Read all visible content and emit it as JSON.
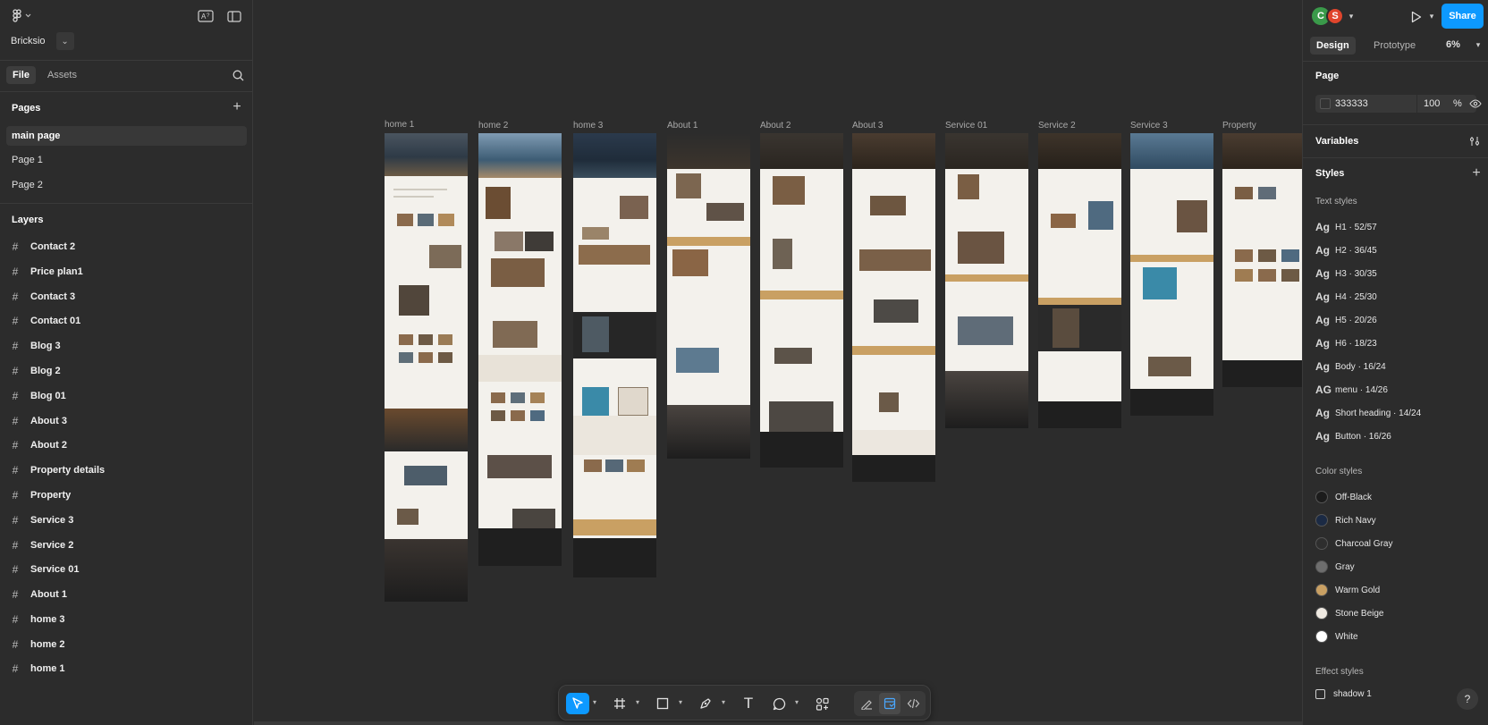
{
  "left": {
    "project_name": "Bricksio",
    "tabs": [
      "File",
      "Assets"
    ],
    "pages_title": "Pages",
    "pages": [
      "main page",
      "Page 1",
      "Page 2"
    ],
    "layers_title": "Layers",
    "layers": [
      "Contact 2",
      "Price plan1",
      "Contact 3",
      "Contact 01",
      "Blog 3",
      "Blog 2",
      "Blog 01",
      "About 3",
      "About 2",
      "Property details",
      "Property",
      "Service 3",
      "Service 2",
      "Service 01",
      "About 1",
      "home 3",
      "home 2",
      "home 1"
    ]
  },
  "canvas": {
    "frames": [
      "home 1",
      "home 2",
      "home 3",
      "About 1",
      "About 2",
      "About 3",
      "Service 01",
      "Service 2",
      "Service 3",
      "Property"
    ]
  },
  "right": {
    "avatars": [
      "C",
      "S"
    ],
    "share_label": "Share",
    "tabs": [
      "Design",
      "Prototype"
    ],
    "zoom": "6%",
    "page_section": "Page",
    "page_color": "333333",
    "page_opacity": "100",
    "page_opacity_unit": "%",
    "variables_title": "Variables",
    "styles_title": "Styles",
    "text_styles_title": "Text styles",
    "text_styles": [
      {
        "ag": "Ag",
        "label": "H1 · 52/57"
      },
      {
        "ag": "Ag",
        "label": "H2 · 36/45"
      },
      {
        "ag": "Ag",
        "label": "H3 · 30/35"
      },
      {
        "ag": "Ag",
        "label": "H4 · 25/30"
      },
      {
        "ag": "Ag",
        "label": "H5 · 20/26"
      },
      {
        "ag": "Ag",
        "label": "H6 · 18/23"
      },
      {
        "ag": "Ag",
        "label": "Body · 16/24"
      },
      {
        "ag": "AG",
        "label": "menu · 14/26"
      },
      {
        "ag": "Ag",
        "label": "Short heading · 14/24"
      },
      {
        "ag": "Ag",
        "label": "Button · 16/26"
      }
    ],
    "color_styles_title": "Color styles",
    "color_styles": [
      {
        "name": "Off-Black",
        "color": "#1c1c1c"
      },
      {
        "name": "Rich Navy",
        "color": "#1b2a44"
      },
      {
        "name": "Charcoal Gray",
        "color": "#2e2e2e"
      },
      {
        "name": "Gray",
        "color": "#6e6e6e"
      },
      {
        "name": "Warm Gold",
        "color": "#c9a063"
      },
      {
        "name": "Stone Beige",
        "color": "#efeae2"
      },
      {
        "name": "White",
        "color": "#ffffff"
      }
    ],
    "effect_styles_title": "Effect styles",
    "effect_styles": [
      "shadow 1"
    ],
    "help": "?"
  }
}
